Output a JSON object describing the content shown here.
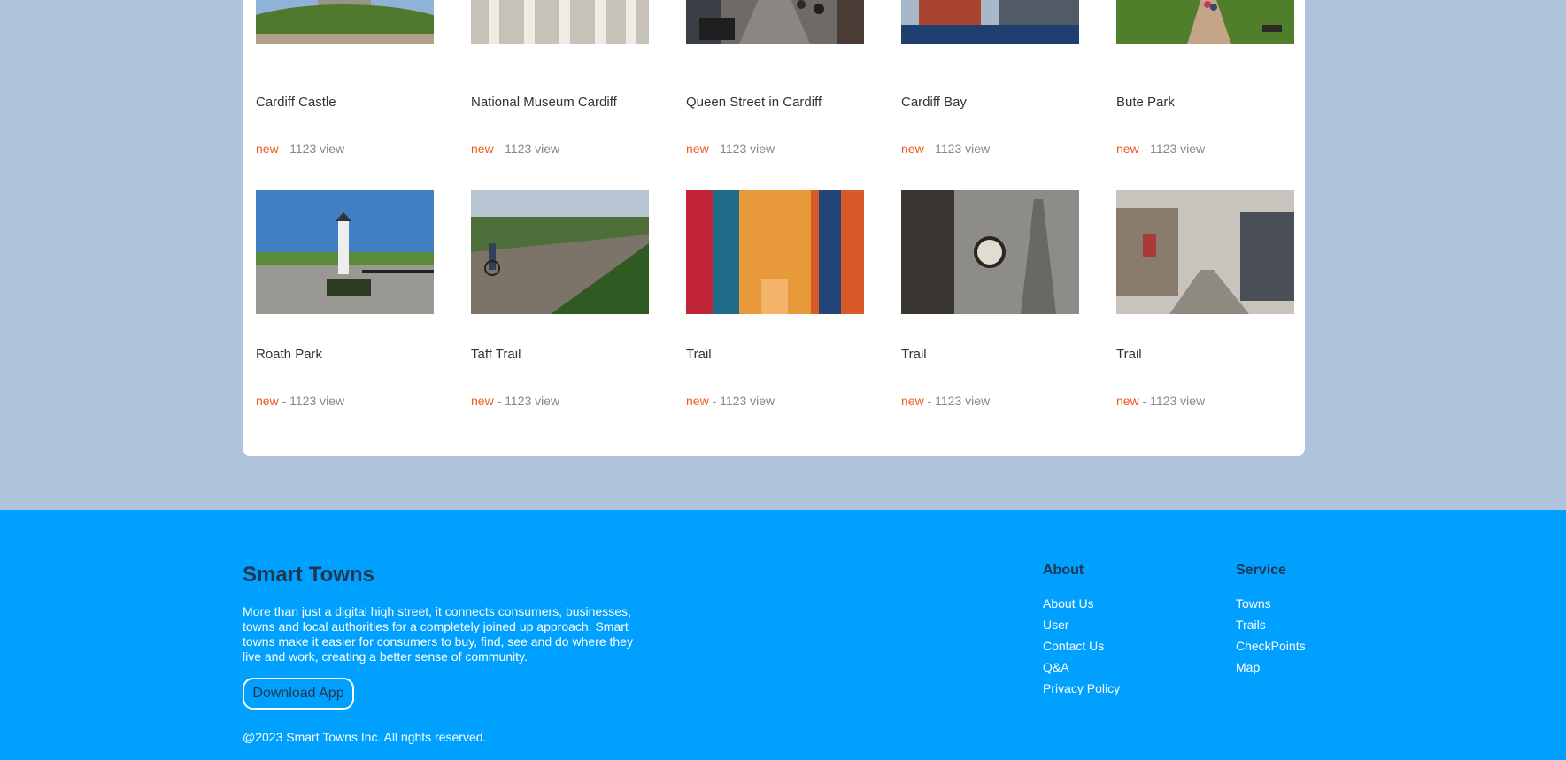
{
  "rows": [
    [
      {
        "title": "Cardiff Castle",
        "badge": "new",
        "views": "- 1123 view",
        "image": "castle-photo"
      },
      {
        "title": "National Museum Cardiff",
        "badge": "new",
        "views": "- 1123 view",
        "image": "museum-photo"
      },
      {
        "title": "Queen Street in Cardiff",
        "badge": "new",
        "views": "- 1123 view",
        "image": "street-photo"
      },
      {
        "title": "Cardiff Bay",
        "badge": "new",
        "views": "- 1123 view",
        "image": "bay-photo"
      },
      {
        "title": "Bute Park",
        "badge": "new",
        "views": "- 1123 view",
        "image": "park-photo"
      }
    ],
    [
      {
        "title": "Roath Park",
        "badge": "new",
        "views": "- 1123 view",
        "image": "lighthouse-photo"
      },
      {
        "title": "Taff Trail",
        "badge": "new",
        "views": "- 1123 view",
        "image": "cyclists-photo"
      },
      {
        "title": "Trail",
        "badge": "new",
        "views": "- 1123 view",
        "image": "canal-photo"
      },
      {
        "title": "Trail",
        "badge": "new",
        "views": "- 1123 view",
        "image": "clock-photo"
      },
      {
        "title": "Trail",
        "badge": "new",
        "views": "- 1123 view",
        "image": "village-photo"
      }
    ]
  ],
  "footer": {
    "brand": "Smart Towns",
    "description": "More than just a digital high street, it connects consumers, businesses, towns and local authorities for a completely joined up approach. Smart towns make it easier for consumers to buy, find, see and do where they live and work, creating a better sense of community.",
    "download_label": "Download App",
    "copyright": "@2023 Smart Towns Inc. All rights reserved.",
    "about": {
      "heading": "About",
      "links": [
        "About Us",
        "User",
        "Contact Us",
        "Q&A",
        "Privacy Policy"
      ]
    },
    "service": {
      "heading": "Service",
      "links": [
        "Towns",
        "Trails",
        "CheckPoints",
        "Map"
      ]
    }
  },
  "colors": {
    "page_background": "#b0c3dd",
    "footer_background": "#00a0ff",
    "badge": "#f05a1e",
    "brand_text": "#1f3550"
  }
}
